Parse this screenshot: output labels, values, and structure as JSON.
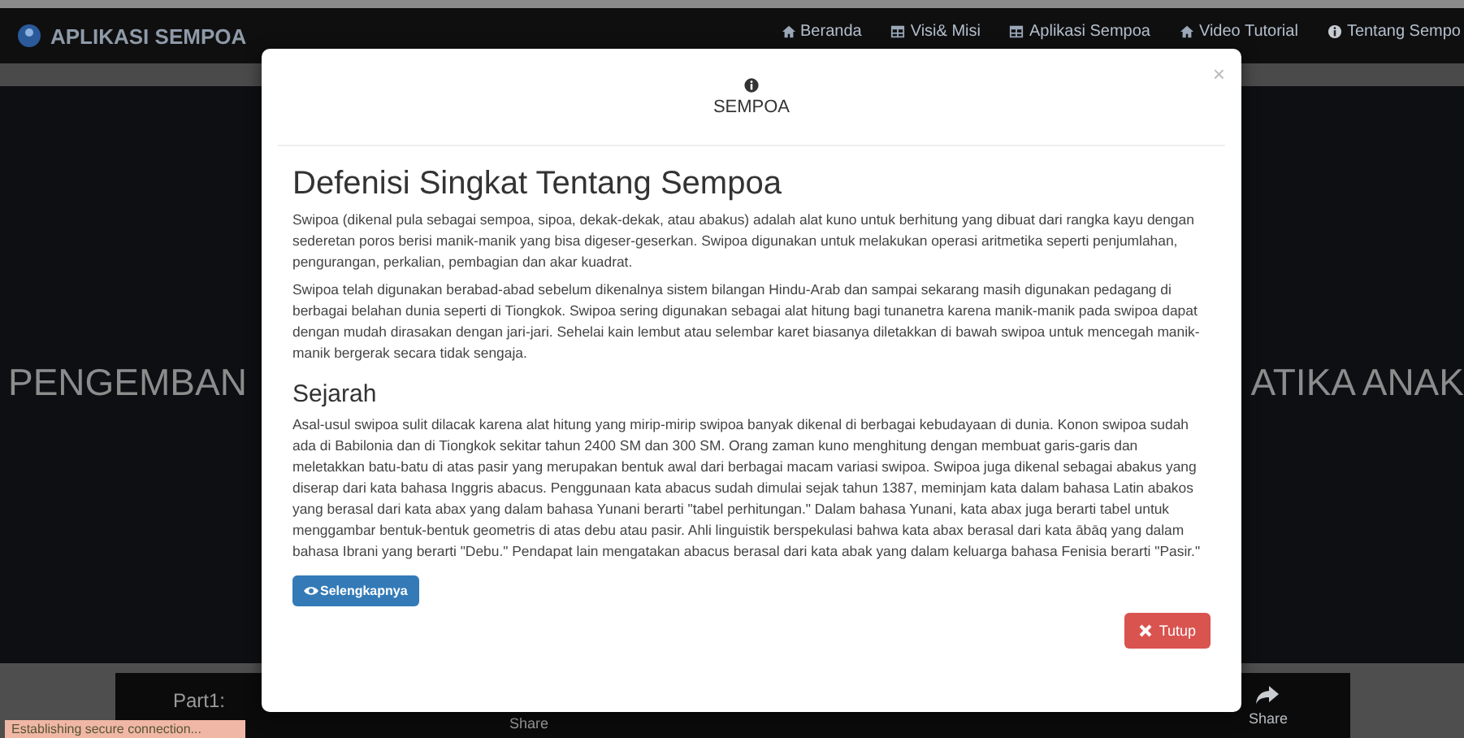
{
  "navbar": {
    "brand": "APLIKASI SEMPOA",
    "items": [
      {
        "label": "Beranda",
        "kind": "home"
      },
      {
        "label": "Visi& Misi",
        "kind": "table"
      },
      {
        "label": "Aplikasi Sempoa",
        "kind": "table"
      },
      {
        "label": "Video Tutorial",
        "kind": "home"
      },
      {
        "label": "Tentang Sempo",
        "kind": "info"
      }
    ]
  },
  "hero": {
    "left_text": "PENGEMBAN",
    "right_text": "ATIKA ANAK"
  },
  "video_bar": {
    "part": "Part1:",
    "share_labels": [
      "Share",
      "Share"
    ]
  },
  "modal": {
    "title": "SEMPOA",
    "close": "×",
    "sections": [
      {
        "heading": "Defenisi Singkat Tentang Sempoa",
        "paragraphs": [
          "Swipoa (dikenal pula sebagai sempoa, sipoa, dekak-dekak, atau abakus) adalah alat kuno untuk berhitung yang dibuat dari rangka kayu dengan sederetan poros berisi manik-manik yang bisa digeser-geserkan. Swipoa digunakan untuk melakukan operasi aritmetika seperti penjumlahan, pengurangan, perkalian, pembagian dan akar kuadrat.",
          "Swipoa telah digunakan berabad-abad sebelum dikenalnya sistem bilangan Hindu-Arab dan sampai sekarang masih digunakan pedagang di berbagai belahan dunia seperti di Tiongkok. Swipoa sering digunakan sebagai alat hitung bagi tunanetra karena manik-manik pada swipoa dapat dengan mudah dirasakan dengan jari-jari. Sehelai kain lembut atau selembar karet biasanya diletakkan di bawah swipoa untuk mencegah manik-manik bergerak secara tidak sengaja."
        ]
      },
      {
        "heading": "Sejarah",
        "paragraphs": [
          "Asal-usul swipoa sulit dilacak karena alat hitung yang mirip-mirip swipoa banyak dikenal di berbagai kebudayaan di dunia. Konon swipoa sudah ada di Babilonia dan di Tiongkok sekitar tahun 2400 SM dan 300 SM. Orang zaman kuno menghitung dengan membuat garis-garis dan meletakkan batu-batu di atas pasir yang merupakan bentuk awal dari berbagai macam variasi swipoa. Swipoa juga dikenal sebagai abakus yang diserap dari kata bahasa Inggris abacus. Penggunaan kata abacus sudah dimulai sejak tahun 1387, meminjam kata dalam bahasa Latin abakos yang berasal dari kata abax yang dalam bahasa Yunani berarti \"tabel perhitungan.\" Dalam bahasa Yunani, kata abax juga berarti tabel untuk menggambar bentuk-bentuk geometris di atas debu atau pasir. Ahli linguistik berspekulasi bahwa kata abax berasal dari kata ābāq yang dalam bahasa Ibrani yang berarti \"Debu.\" Pendapat lain mengatakan abacus berasal dari kata abak yang dalam keluarga bahasa Fenisia berarti \"Pasir.\""
        ]
      }
    ],
    "more_button": "Selengkapnya",
    "close_button": "Tutup"
  },
  "status_bar": "Establishing secure connection..."
}
